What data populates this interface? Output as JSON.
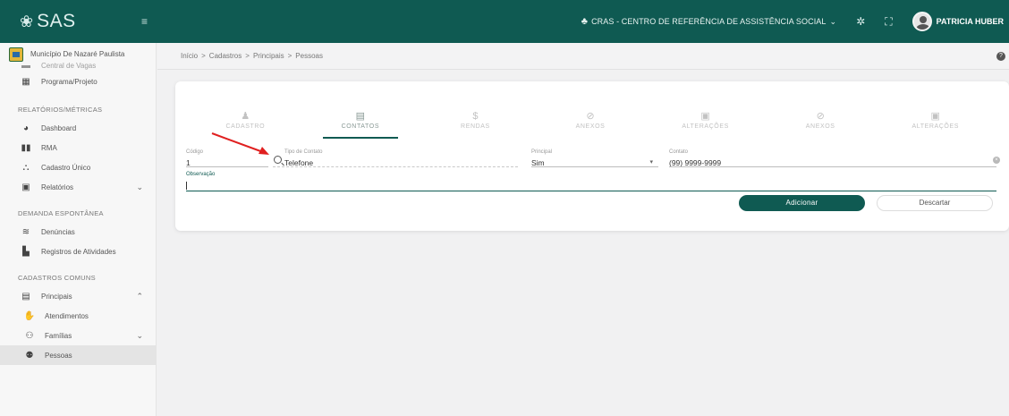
{
  "app": {
    "name": "SAS"
  },
  "header": {
    "unit": "CRAS - CENTRO DE REFERÊNCIA DE ASSISTÊNCIA SOCIAL",
    "user": "PATRICIA HUBER",
    "colors": {
      "primary": "#0f5a52"
    }
  },
  "sidebar": {
    "municipality": "Município De Nazaré Paulista",
    "partial_item": "Central de Vagas",
    "items_top": [
      {
        "label": "Programa/Projeto",
        "icon": "building-icon"
      }
    ],
    "section_reports": "RELATÓRIOS/MÉTRICAS",
    "reports": [
      {
        "label": "Dashboard",
        "icon": "dashboard-icon"
      },
      {
        "label": "RMA",
        "icon": "chart-icon"
      },
      {
        "label": "Cadastro Único",
        "icon": "people-icon"
      },
      {
        "label": "Relatórios",
        "icon": "clipboard-icon"
      }
    ],
    "section_demand": "DEMANDA ESPONTÂNEA",
    "demand": [
      {
        "label": "Denúncias",
        "icon": "megaphone-icon"
      },
      {
        "label": "Registros de Atividades",
        "icon": "file-edit-icon"
      }
    ],
    "section_common": "CADASTROS COMUNS",
    "common": [
      {
        "label": "Principais",
        "icon": "list-icon"
      },
      {
        "label": "Atendimentos",
        "icon": "handshake-icon"
      },
      {
        "label": "Famílias",
        "icon": "family-icon"
      },
      {
        "label": "Pessoas",
        "icon": "person-icon"
      }
    ]
  },
  "breadcrumb": {
    "items": [
      "Início",
      "Cadastros",
      "Principais",
      "Pessoas"
    ],
    "separator": ">"
  },
  "tabs": [
    {
      "label": "CADASTRO",
      "icon": "person-icon"
    },
    {
      "label": "CONTATOS",
      "icon": "contact-icon"
    },
    {
      "label": "RENDAS",
      "icon": "money-icon"
    },
    {
      "label": "ANEXOS",
      "icon": "attachment-icon"
    },
    {
      "label": "ALTERAÇÕES",
      "icon": "history-icon"
    },
    {
      "label": "ANEXOS",
      "icon": "attachment-icon"
    },
    {
      "label": "ALTERAÇÕES",
      "icon": "history-icon"
    }
  ],
  "form": {
    "codigo": {
      "label": "Código",
      "value": "1"
    },
    "tipo": {
      "label": "Tipo de Contato",
      "value": "Telefone"
    },
    "principal": {
      "label": "Principal",
      "value": "Sim"
    },
    "contato": {
      "label": "Contato",
      "value": "(99) 9999-9999"
    },
    "observacao": {
      "label": "Observação",
      "value": ""
    },
    "add_label": "Adicionar",
    "discard_label": "Descartar"
  }
}
